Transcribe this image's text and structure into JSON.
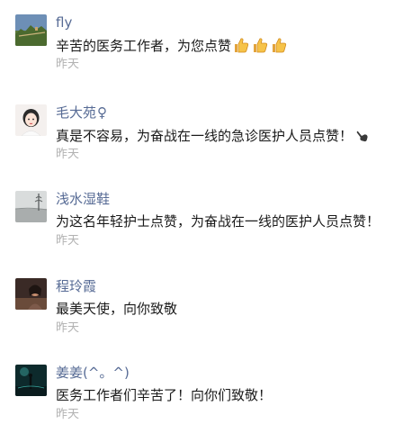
{
  "comments": [
    {
      "name": "fly",
      "text": "辛苦的医务工作者，为您点赞",
      "emoji": [
        "thumbs-up-emoji",
        "thumbs-up-emoji",
        "thumbs-up-emoji"
      ],
      "time": "昨天"
    },
    {
      "name": "毛大苑",
      "name_symbol": "♀",
      "text": "真是不容易，为奋战在一线的急诊医护人员点赞！",
      "emoji": [
        "pointing-hand-emoji"
      ],
      "time": "昨天"
    },
    {
      "name": "浅水湿鞋",
      "text": "为这名年轻护士点赞，为奋战在一线的医护人员点赞！",
      "time": "昨天"
    },
    {
      "name": "程玲霞",
      "text": "最美天使，向你致敬",
      "time": "昨天"
    },
    {
      "name": "姜姜(^。^)",
      "text": "医务工作者们辛苦了！向你们致敬！",
      "time": "昨天"
    }
  ],
  "colors": {
    "name": "#576b95",
    "text": "#1a1a1a",
    "time": "#b2b2b2"
  }
}
